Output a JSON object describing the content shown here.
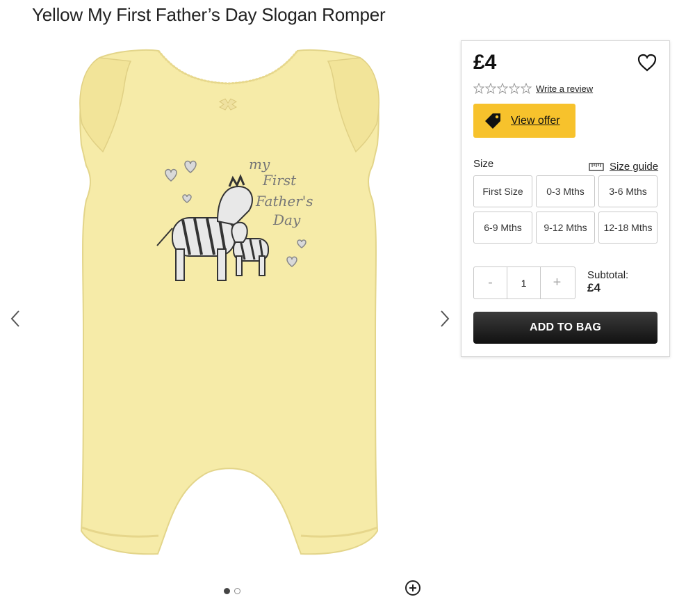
{
  "product": {
    "title": "Yellow My First Father’s Day Slogan Romper"
  },
  "gallery": {
    "image_text": [
      "my",
      "First",
      "Father's",
      "Day"
    ],
    "prev_icon": "chevron-left-icon",
    "next_icon": "chevron-right-icon",
    "zoom_icon": "zoom-plus-icon",
    "dots": 2,
    "active_dot": 1
  },
  "panel": {
    "price": "£4",
    "wishlist_icon": "heart-icon",
    "rating": {
      "stars": 0,
      "max": 5,
      "review_link": "Write a review"
    },
    "offer": {
      "label": "View offer",
      "icon": "tag-icon",
      "color": "#f7c22c"
    },
    "size": {
      "label": "Size",
      "guide_label": "Size guide",
      "options": [
        "First Size",
        "0-3 Mths",
        "3-6 Mths",
        "6-9 Mths",
        "9-12 Mths",
        "12-18 Mths"
      ]
    },
    "quantity": {
      "minus": "-",
      "value": "1",
      "plus": "+"
    },
    "subtotal": {
      "label": "Subtotal:",
      "value": "£4"
    },
    "add_to_bag": "ADD TO BAG"
  },
  "colors": {
    "romper": "#f6eba8",
    "button_dark": "#1f1f1f"
  }
}
